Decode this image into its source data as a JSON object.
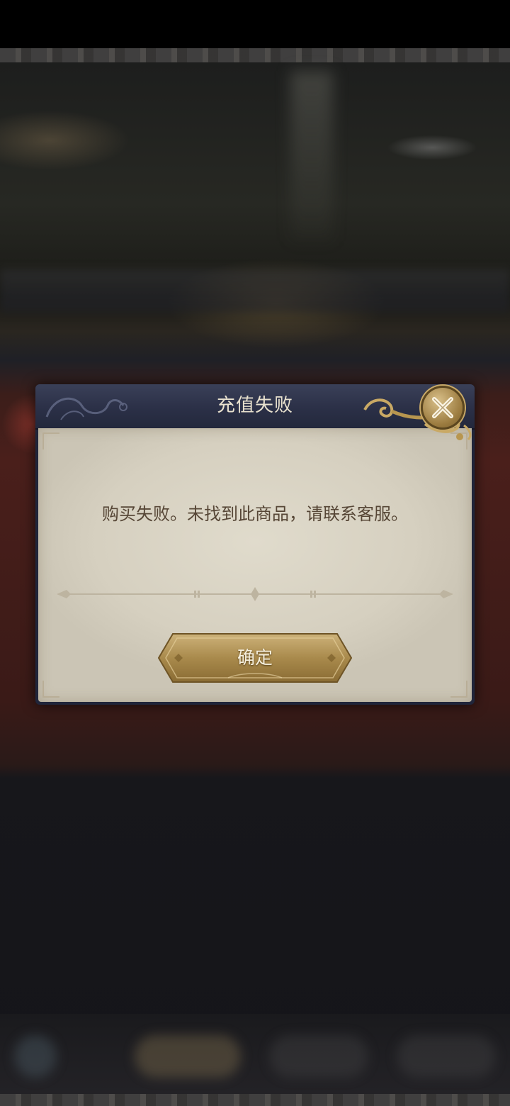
{
  "dialog": {
    "title": "充值失败",
    "message": "购买失败。未找到此商品，请联系客服。",
    "confirm_label": "确定",
    "close_icon": "close-x-icon"
  },
  "colors": {
    "header_bg": "#2b3047",
    "body_bg": "#d6d0c0",
    "gold": "#b8964f",
    "message_text": "#564636",
    "title_text": "#e9e2cf"
  }
}
